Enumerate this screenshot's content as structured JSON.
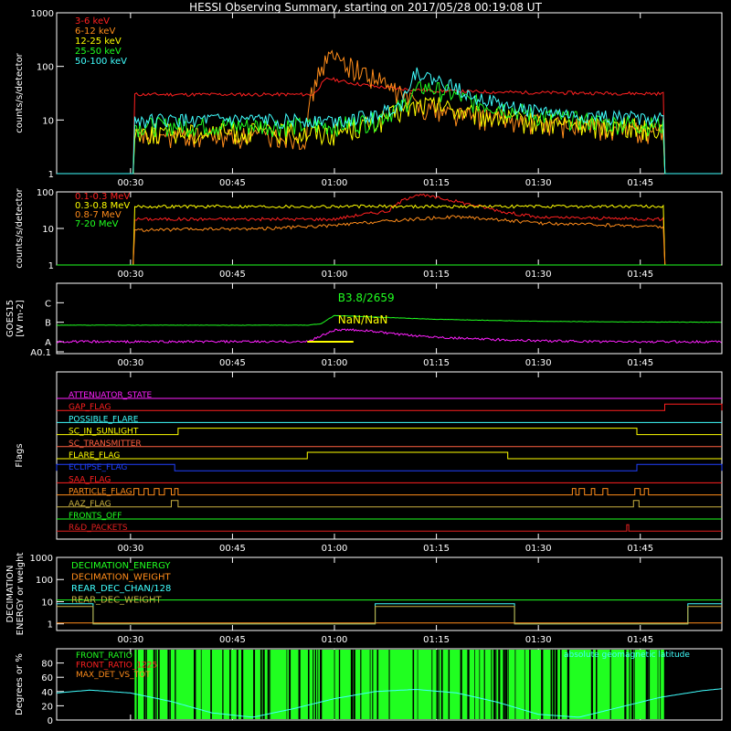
{
  "title": "HESSI Observing Summary, starting on 2017/05/28 00:19:08 UT",
  "colors": {
    "background": "#000000",
    "axes": "#ffffff",
    "red": "#ff2020",
    "orange": "#ff8c1a",
    "yellow": "#ffff00",
    "green": "#20ff20",
    "cyan": "#40ffff",
    "magenta": "#ff20ff",
    "blue": "#2040ff",
    "salmon": "#ff6040",
    "olive": "#c8b040",
    "darkred": "#e02020"
  },
  "time_axis": {
    "tick_labels": [
      "00:30",
      "00:45",
      "01:00",
      "01:15",
      "01:30",
      "01:45"
    ],
    "tick_minutes": [
      30,
      45,
      60,
      75,
      90,
      105
    ],
    "range_minutes": [
      19.13,
      117
    ]
  },
  "chart_data": [
    {
      "type": "line",
      "ylabel": "counts/s/detector",
      "log_scale": true,
      "ylim": [
        1,
        1000
      ],
      "y_ticks": [
        "1",
        "10",
        "100",
        "1000"
      ],
      "series": [
        {
          "name": "3-6 keV",
          "color": "#ff2020",
          "x": [
            19.13,
            30.5,
            30.6,
            57,
            59,
            62,
            66,
            70,
            75,
            85,
            95,
            108.5,
            108.6,
            117
          ],
          "y": [
            1,
            1,
            30,
            30,
            60,
            50,
            42,
            38,
            35,
            33,
            32,
            31,
            1,
            1
          ]
        },
        {
          "name": "6-12 keV",
          "color": "#ff8c1a",
          "x": [
            19.13,
            30.5,
            30.6,
            56,
            57.5,
            59,
            61,
            64,
            68,
            72,
            76,
            80,
            90,
            100,
            108.5,
            108.6,
            117
          ],
          "y": [
            1,
            1,
            5,
            5,
            60,
            150,
            130,
            80,
            40,
            20,
            15,
            12,
            9,
            7,
            6,
            1,
            1
          ]
        },
        {
          "name": "12-25 keV",
          "color": "#ffff00",
          "x": [
            19.13,
            30.5,
            30.6,
            60,
            66,
            70,
            73,
            76,
            80,
            90,
            100,
            108.5,
            108.6,
            117
          ],
          "y": [
            1,
            1,
            6,
            6,
            9,
            15,
            20,
            18,
            13,
            9,
            8,
            7,
            1,
            1
          ]
        },
        {
          "name": "25-50 keV",
          "color": "#20ff20",
          "x": [
            19.13,
            30.5,
            30.6,
            60,
            66,
            70,
            73,
            76,
            80,
            90,
            100,
            108.5,
            108.6,
            117
          ],
          "y": [
            1,
            1,
            8,
            8,
            10,
            18,
            42,
            35,
            22,
            12,
            9,
            8,
            1,
            1
          ]
        },
        {
          "name": "50-100 keV",
          "color": "#40ffff",
          "x": [
            19.13,
            30.5,
            30.6,
            60,
            66,
            70,
            72,
            74,
            77,
            80,
            85,
            95,
            108.5,
            108.6,
            117
          ],
          "y": [
            1,
            1,
            10,
            10,
            12,
            20,
            80,
            60,
            45,
            30,
            18,
            12,
            11,
            1,
            1
          ]
        }
      ]
    },
    {
      "type": "line",
      "ylabel": "counts/s/detector",
      "log_scale": true,
      "ylim": [
        1,
        100
      ],
      "y_ticks": [
        "1",
        "10",
        "100"
      ],
      "series": [
        {
          "name": "0.1-0.3 MeV",
          "color": "#ff2020",
          "x": [
            19.13,
            30.5,
            30.6,
            60,
            68,
            72,
            76,
            80,
            85,
            90,
            108.5,
            108.6,
            117
          ],
          "y": [
            1,
            1,
            18,
            18,
            30,
            85,
            65,
            45,
            28,
            20,
            18,
            1,
            1
          ]
        },
        {
          "name": "0.3-0.8 MeV",
          "color": "#ffff00",
          "x": [
            19.13,
            30.5,
            30.6,
            108.5,
            108.6,
            117
          ],
          "y": [
            1,
            1,
            40,
            40,
            1,
            1
          ]
        },
        {
          "name": "0.8-7 MeV",
          "color": "#ff8c1a",
          "x": [
            19.13,
            30.5,
            30.6,
            50,
            60,
            70,
            78,
            90,
            108.5,
            108.6,
            117
          ],
          "y": [
            1,
            1,
            9,
            10,
            12,
            17,
            21,
            14,
            11,
            1,
            1
          ]
        },
        {
          "name": "7-20 MeV",
          "color": "#20ff20",
          "x": [
            19.13,
            117
          ],
          "y": [
            1,
            1
          ]
        }
      ]
    },
    {
      "type": "line",
      "ylabel": "GOES15 [W m-2]",
      "y_ticks": [
        "A0.1",
        "A",
        "B",
        "C"
      ],
      "annotations": [
        {
          "text": "B3.8/2659",
          "color": "#20ff20"
        },
        {
          "text": "NaN/NaN",
          "color": "#ffff00"
        }
      ],
      "series": [
        {
          "color": "#20ff20",
          "x": [
            19.13,
            56,
            58,
            60,
            65,
            75,
            90,
            100,
            117
          ],
          "y": [
            0.85,
            0.85,
            0.92,
            1.35,
            1.28,
            1.15,
            1.05,
            1.02,
            1.0
          ]
        },
        {
          "color": "#ff20ff",
          "x": [
            19.13,
            56,
            58,
            60,
            64,
            70,
            80,
            90,
            100,
            117
          ],
          "y": [
            0.0,
            0.0,
            0.3,
            0.6,
            0.6,
            0.35,
            0.15,
            0.05,
            0.0,
            0.0
          ]
        },
        {
          "color": "#ffff00",
          "x": [
            56,
            63
          ],
          "y": [
            0.0,
            0.0
          ]
        }
      ]
    },
    {
      "type": "table",
      "ylabel": "Flags",
      "flags": [
        {
          "name": "ATTENUATOR_STATE",
          "color": "#ff20ff",
          "on": []
        },
        {
          "name": "GAP_FLAG",
          "color": "#ff2020",
          "on": [
            [
              108.6,
              117
            ]
          ]
        },
        {
          "name": "POSSIBLE_FLARE",
          "color": "#40ffff",
          "on": []
        },
        {
          "name": "SC_IN_SUNLIGHT",
          "color": "#ffff00",
          "on": [
            [
              37,
              104.5
            ]
          ]
        },
        {
          "name": "SC_TRANSMITTER",
          "color": "#ff6040",
          "on": []
        },
        {
          "name": "FLARE_FLAG",
          "color": "#ffff00",
          "on": [
            [
              56,
              85.5
            ]
          ]
        },
        {
          "name": "ECLIPSE_FLAG",
          "color": "#2040ff",
          "on": [
            [
              19.13,
              36.5
            ],
            [
              104.5,
              117
            ]
          ]
        },
        {
          "name": "SAA_FLAG",
          "color": "#ff2020",
          "on": []
        },
        {
          "name": "PARTICLE_FLAG",
          "color": "#ff8c1a",
          "on": [
            [
              30.5,
              31.2
            ],
            [
              32,
              32.6
            ],
            [
              33.5,
              34.2
            ],
            [
              35,
              36
            ],
            [
              36.5,
              37
            ],
            [
              95,
              95.5
            ],
            [
              96,
              96.8
            ],
            [
              97.8,
              98.3
            ],
            [
              99.5,
              100.2
            ],
            [
              104.2,
              105
            ],
            [
              105.6,
              106.2
            ]
          ]
        },
        {
          "name": "AAZ_FLAG",
          "color": "#c8b040",
          "on": [
            [
              36,
              37
            ],
            [
              104,
              104.8
            ]
          ]
        },
        {
          "name": "FRONTS_OFF",
          "color": "#20ff20",
          "on": []
        },
        {
          "name": "R&D_PACKETS",
          "color": "#e02020",
          "on": [
            [
              103,
              103.3
            ]
          ]
        }
      ]
    },
    {
      "type": "line",
      "ylabel": "DECIMATION ENERGY or weight",
      "log_scale": true,
      "ylim": [
        0.5,
        1000
      ],
      "y_ticks": [
        "1",
        "10",
        "100",
        "1000"
      ],
      "series": [
        {
          "name": "DECIMATION_ENERGY",
          "color": "#20ff20",
          "x": [
            19.13,
            117
          ],
          "y": [
            12,
            12
          ]
        },
        {
          "name": "DECIMATION_WEIGHT",
          "color": "#ff8c1a",
          "x": [
            19.13,
            117
          ],
          "y": [
            1,
            1
          ]
        },
        {
          "name": "REAR_DEC_CHAN/128",
          "color": "#40ffff",
          "x": [
            19.13,
            24.5,
            24.5,
            66,
            66,
            86.5,
            86.5,
            112,
            112,
            117
          ],
          "y": [
            8,
            8,
            1,
            1,
            8,
            8,
            1,
            1,
            8,
            8
          ]
        },
        {
          "name": "REAR_DEC_WEIGHT",
          "color": "#c8b040",
          "x": [
            19.13,
            24.5,
            24.5,
            66,
            66,
            86.5,
            86.5,
            112,
            112,
            117
          ],
          "y": [
            6,
            6,
            1,
            1,
            6,
            6,
            1,
            1,
            6,
            6
          ]
        }
      ]
    },
    {
      "type": "area",
      "ylabel": "Degrees or %",
      "ylim": [
        0,
        100
      ],
      "y_ticks": [
        "0",
        "20",
        "40",
        "60",
        "80"
      ],
      "series": [
        {
          "name": "FRONT_RATIO",
          "color": "#20ff20",
          "on": [
            [
              30.6,
              108.5
            ]
          ]
        },
        {
          "name": "FRONT_RATIO_1225",
          "color": "#ff2020"
        },
        {
          "name": "MAX_DET_VS_TOT",
          "color": "#ff8c1a"
        },
        {
          "name": "absolute geomagnetic latitude",
          "color": "#40ffff",
          "x": [
            19.13,
            24,
            30,
            36,
            42,
            48,
            54,
            60,
            66,
            72,
            78,
            84,
            90,
            96,
            102,
            108,
            114,
            117
          ],
          "y": [
            38,
            42,
            38,
            26,
            10,
            4,
            16,
            30,
            40,
            43,
            38,
            25,
            8,
            4,
            18,
            32,
            41,
            44
          ]
        }
      ]
    }
  ]
}
